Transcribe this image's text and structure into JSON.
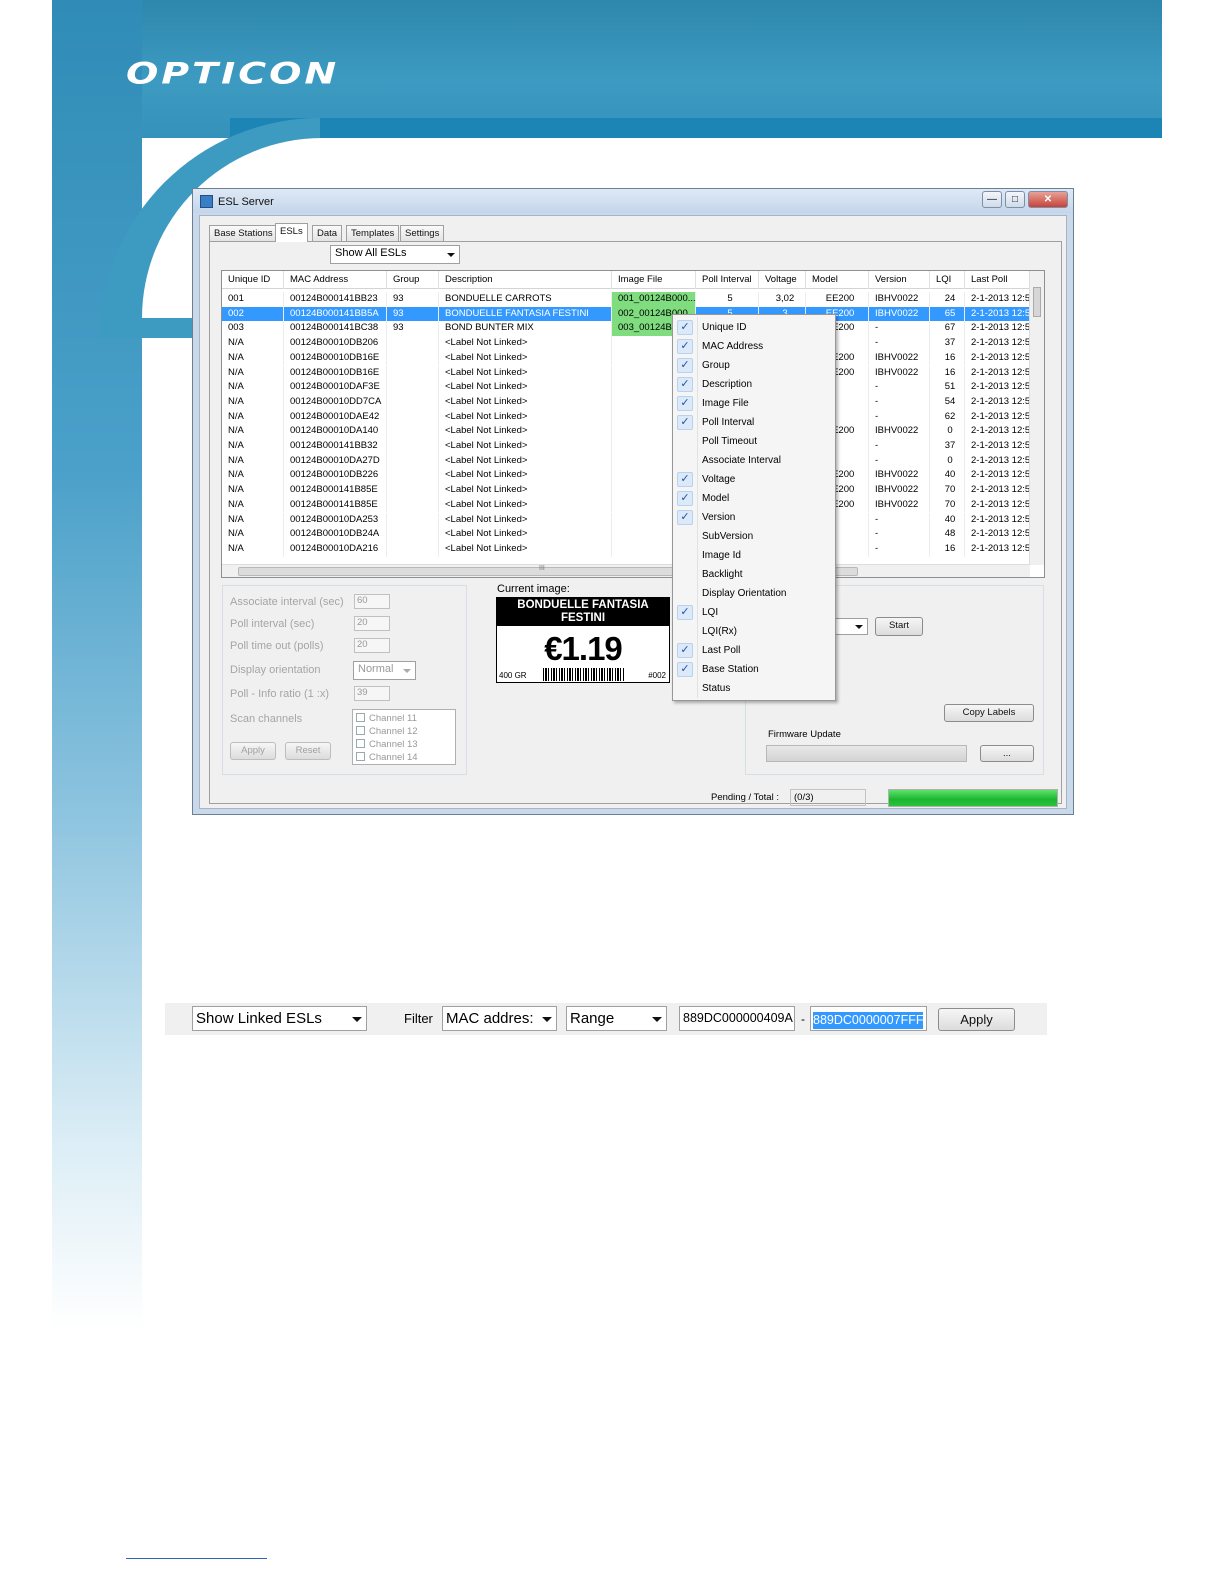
{
  "brand": {
    "logo_text": "OPTICON"
  },
  "window": {
    "title": "ESL Server",
    "controls": {
      "minimize": "—",
      "maximize": "□",
      "close": "✕"
    },
    "tabs": [
      "Base Stations",
      "ESLs",
      "Data",
      "Templates",
      "Settings"
    ],
    "active_tab": "ESLs",
    "view_filter": "Show All ESLs"
  },
  "grid": {
    "columns": [
      "Unique ID",
      "MAC Address",
      "Group",
      "Description",
      "Image File",
      "Poll Interval",
      "Voltage",
      "Model",
      "Version",
      "LQI",
      "Last Poll"
    ],
    "rows": [
      [
        "001",
        "00124B000141BB23",
        "93",
        "BONDUELLE CARROTS",
        "001_00124B000...",
        "5",
        "3,02",
        "EE200",
        "IBHV0022",
        "24",
        "2-1-2013 12:5"
      ],
      [
        "002",
        "00124B000141BB5A",
        "93",
        "BONDUELLE FANTASIA FESTINI",
        "002_00124B000...",
        "5",
        "3",
        "EE200",
        "IBHV0022",
        "65",
        "2-1-2013 12:5"
      ],
      [
        "003",
        "00124B000141BC38",
        "93",
        "BOND BUNTER MIX",
        "003_00124B000...",
        "",
        "",
        "EE200",
        "-",
        "67",
        "2-1-2013 12:5"
      ],
      [
        "N/A",
        "00124B00010DB206",
        "",
        "<Label Not Linked>",
        "",
        "",
        "",
        "",
        "-",
        "37",
        "2-1-2013 12:5"
      ],
      [
        "N/A",
        "00124B00010DB16E",
        "",
        "<Label Not Linked>",
        "",
        "",
        "",
        "EE200",
        "IBHV0022",
        "16",
        "2-1-2013 12:5"
      ],
      [
        "N/A",
        "00124B00010DB16E",
        "",
        "<Label Not Linked>",
        "",
        "",
        "",
        "EE200",
        "IBHV0022",
        "16",
        "2-1-2013 12:5"
      ],
      [
        "N/A",
        "00124B00010DAF3E",
        "",
        "<Label Not Linked>",
        "",
        "",
        "",
        "",
        "-",
        "51",
        "2-1-2013 12:5"
      ],
      [
        "N/A",
        "00124B00010DD7CA",
        "",
        "<Label Not Linked>",
        "",
        "",
        "",
        "",
        "-",
        "54",
        "2-1-2013 12:5"
      ],
      [
        "N/A",
        "00124B00010DAE42",
        "",
        "<Label Not Linked>",
        "",
        "",
        "",
        "",
        "-",
        "62",
        "2-1-2013 12:5"
      ],
      [
        "N/A",
        "00124B00010DA140",
        "",
        "<Label Not Linked>",
        "",
        "",
        "",
        "EE200",
        "IBHV0022",
        "0",
        "2-1-2013 12:5"
      ],
      [
        "N/A",
        "00124B000141BB32",
        "",
        "<Label Not Linked>",
        "",
        "",
        "",
        "",
        "-",
        "37",
        "2-1-2013 12:5"
      ],
      [
        "N/A",
        "00124B00010DA27D",
        "",
        "<Label Not Linked>",
        "",
        "",
        "",
        "",
        "-",
        "0",
        "2-1-2013 12:5"
      ],
      [
        "N/A",
        "00124B00010DB226",
        "",
        "<Label Not Linked>",
        "",
        "",
        "",
        "EE200",
        "IBHV0022",
        "40",
        "2-1-2013 12:5"
      ],
      [
        "N/A",
        "00124B000141B85E",
        "",
        "<Label Not Linked>",
        "",
        "",
        "",
        "EE200",
        "IBHV0022",
        "70",
        "2-1-2013 12:5"
      ],
      [
        "N/A",
        "00124B000141B85E",
        "",
        "<Label Not Linked>",
        "",
        "",
        "",
        "EE200",
        "IBHV0022",
        "70",
        "2-1-2013 12:5"
      ],
      [
        "N/A",
        "00124B00010DA253",
        "",
        "<Label Not Linked>",
        "",
        "",
        "",
        "",
        "-",
        "40",
        "2-1-2013 12:5"
      ],
      [
        "N/A",
        "00124B00010DB24A",
        "",
        "<Label Not Linked>",
        "",
        "",
        "",
        "",
        "-",
        "48",
        "2-1-2013 12:5"
      ],
      [
        "N/A",
        "00124B00010DA216",
        "",
        "<Label Not Linked>",
        "",
        "",
        "",
        "",
        "-",
        "16",
        "2-1-2013 12:5"
      ]
    ],
    "selected_row": 1,
    "scroll_thumb_glyph": "III"
  },
  "settings": {
    "associate_interval_label": "Associate interval (sec)",
    "associate_interval_value": "60",
    "poll_interval_label": "Poll interval (sec)",
    "poll_interval_value": "20",
    "poll_timeout_label": "Poll time out (polls)",
    "poll_timeout_value": "20",
    "display_orientation_label": "Display orientation",
    "display_orientation_value": "Normal",
    "poll_info_ratio_label": "Poll - Info ratio (1 :x)",
    "poll_info_ratio_value": "39",
    "scan_channels_label": "Scan channels",
    "channels": [
      "Channel 11",
      "Channel 12",
      "Channel 13",
      "Channel 14"
    ],
    "apply_label": "Apply",
    "reset_label": "Reset"
  },
  "preview": {
    "label": "Current image:",
    "product_name": "BONDUELLE FANTASIA FESTINI",
    "price": "€1.19",
    "weight": "400 GR",
    "code": "#002"
  },
  "actions": {
    "start_label": "Start",
    "copy_labels_label": "Copy Labels",
    "firmware_update_label": "Firmware Update",
    "browse_label": "..."
  },
  "status": {
    "pending_total_label": "Pending / Total :",
    "pending_total_value": "(0/3)",
    "progress": 1.0
  },
  "context_menu": {
    "items": [
      {
        "label": "Unique ID",
        "checked": true
      },
      {
        "label": "MAC Address",
        "checked": true
      },
      {
        "label": "Group",
        "checked": true
      },
      {
        "label": "Description",
        "checked": true
      },
      {
        "label": "Image File",
        "checked": true
      },
      {
        "label": "Poll Interval",
        "checked": true
      },
      {
        "label": "Poll Timeout",
        "checked": false
      },
      {
        "label": "Associate Interval",
        "checked": false
      },
      {
        "label": "Voltage",
        "checked": true
      },
      {
        "label": "Model",
        "checked": true
      },
      {
        "label": "Version",
        "checked": true
      },
      {
        "label": "SubVersion",
        "checked": false
      },
      {
        "label": "Image Id",
        "checked": false
      },
      {
        "label": "Backlight",
        "checked": false
      },
      {
        "label": "Display Orientation",
        "checked": false
      },
      {
        "label": "LQI",
        "checked": true
      },
      {
        "label": "LQI(Rx)",
        "checked": false
      },
      {
        "label": "Last Poll",
        "checked": true
      },
      {
        "label": "Base Station",
        "checked": true
      },
      {
        "label": "Status",
        "checked": false
      }
    ],
    "check_glyph": "✓"
  },
  "filter_bar": {
    "view": "Show Linked ESLs",
    "filter_label": "Filter",
    "field": "MAC addres:",
    "mode": "Range",
    "from": "889DC000000409A",
    "separator": "-",
    "to": "889DC0000007FFF",
    "apply_label": "Apply"
  },
  "colors": {
    "brand_blue": "#3d9bc2",
    "selection": "#3399ff",
    "image_cell": "#7fdc7f",
    "progress": "#22c23a"
  }
}
